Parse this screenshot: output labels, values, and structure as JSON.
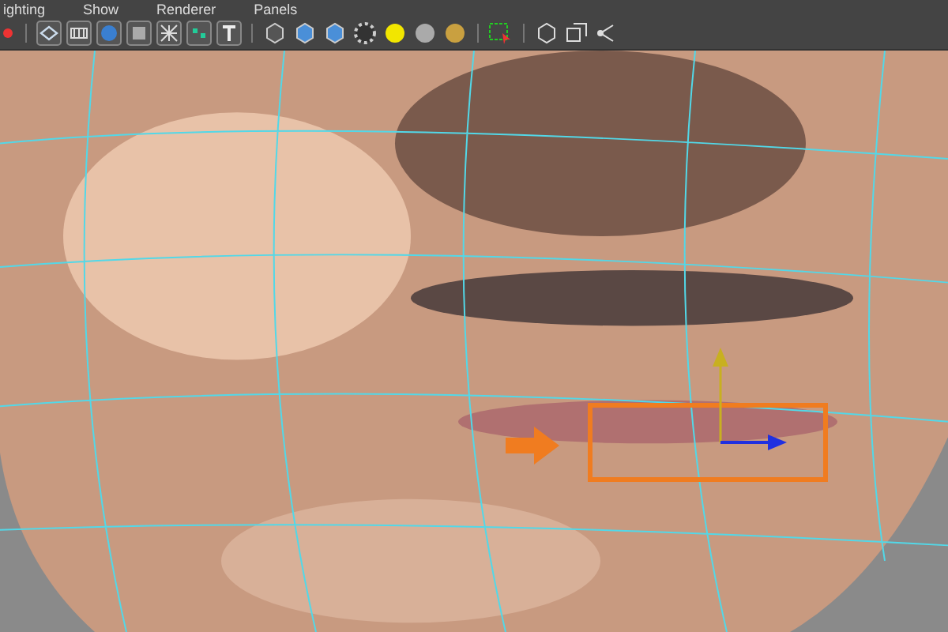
{
  "menu": [
    {
      "label": "ighting"
    },
    {
      "label": "Show"
    },
    {
      "label": "Renderer"
    },
    {
      "label": "Panels"
    }
  ]
}
